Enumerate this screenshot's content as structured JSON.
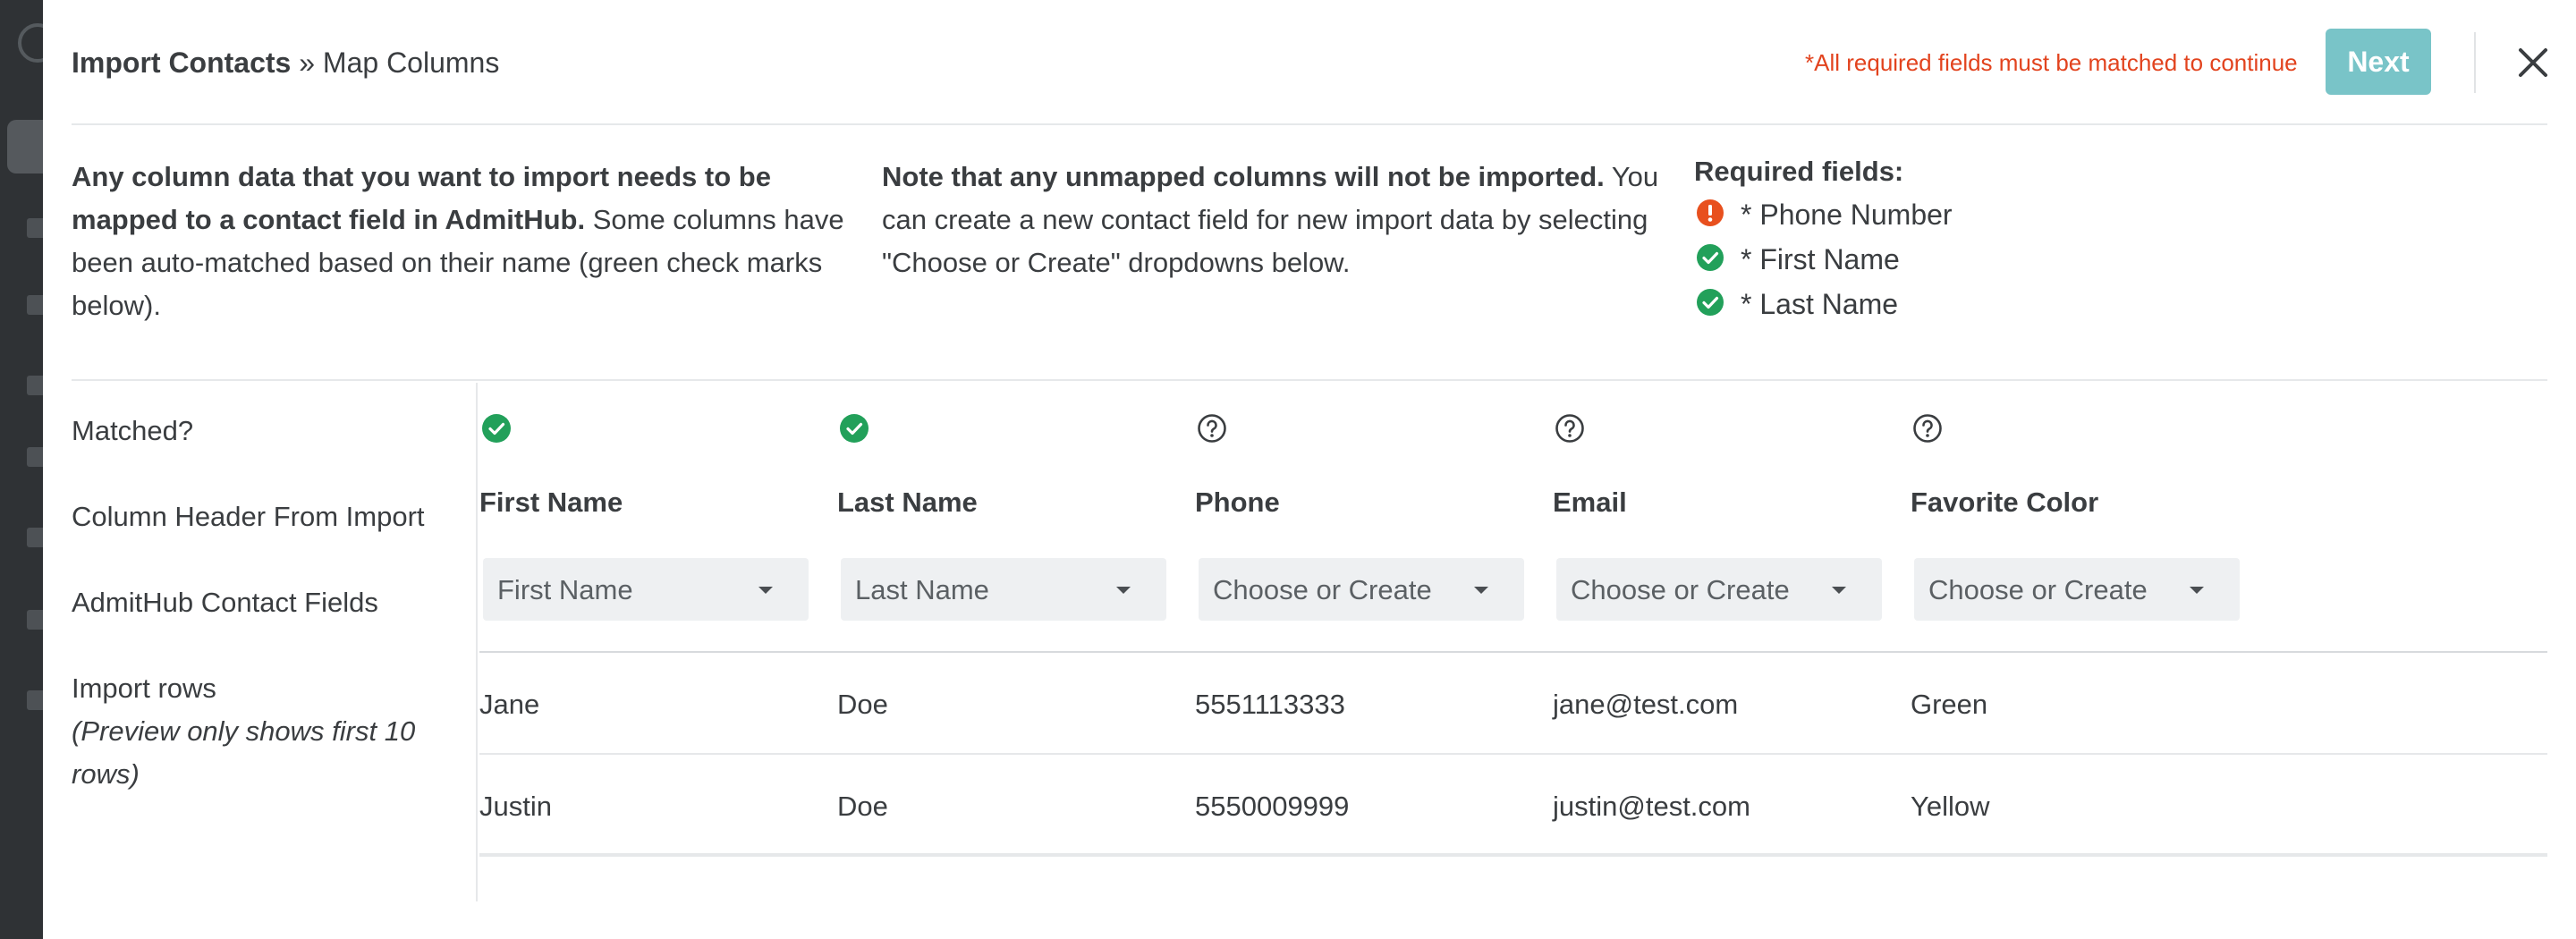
{
  "header": {
    "title_bold": "Import Contacts",
    "title_rest": " » Map Columns",
    "required_note": "*All required fields must be matched to continue",
    "next_label": "Next"
  },
  "intro": {
    "col1_bold": "Any column data that you want to import needs to be mapped to a contact field in AdmitHub.",
    "col1_rest": " Some columns have been auto-matched based on their name (green check marks below).",
    "col2_bold": "Note that any unmapped columns will not be imported.",
    "col2_rest": " You can create a new contact field for new import data by selecting \"Choose or Create\" dropdowns below."
  },
  "required_fields": {
    "title": "Required fields:",
    "items": [
      {
        "label": "* Phone Number",
        "status": "missing",
        "icon": "alert-icon",
        "color": "#e8501e"
      },
      {
        "label": "* First Name",
        "status": "matched",
        "icon": "check-circle-icon",
        "color": "#22a05a"
      },
      {
        "label": "* Last Name",
        "status": "matched",
        "icon": "check-circle-icon",
        "color": "#22a05a"
      }
    ]
  },
  "row_labels": {
    "matched": "Matched?",
    "column_header": "Column Header From Import",
    "contact_fields": "AdmitHub Contact Fields",
    "import_rows": "Import rows",
    "import_rows_note": "(Preview only shows first 10 rows)"
  },
  "columns": [
    {
      "header": "First Name",
      "matched": true,
      "field": "First Name",
      "icon": "check-circle-icon"
    },
    {
      "header": "Last Name",
      "matched": true,
      "field": "Last Name",
      "icon": "check-circle-icon"
    },
    {
      "header": "Phone",
      "matched": false,
      "field": "Choose or Create",
      "icon": "question-circle-icon"
    },
    {
      "header": "Email",
      "matched": false,
      "field": "Choose or Create",
      "icon": "question-circle-icon"
    },
    {
      "header": "Favorite Color",
      "matched": false,
      "field": "Choose or Create",
      "icon": "question-circle-icon"
    }
  ],
  "rows": [
    [
      "Jane",
      "Doe",
      "5551113333",
      "jane@test.com",
      "Green"
    ],
    [
      "Justin",
      "Doe",
      "5550009999",
      "justin@test.com",
      "Yellow"
    ]
  ],
  "colors": {
    "accent_button": "#79c4c8",
    "error": "#e2431e",
    "success": "#22a05a"
  }
}
